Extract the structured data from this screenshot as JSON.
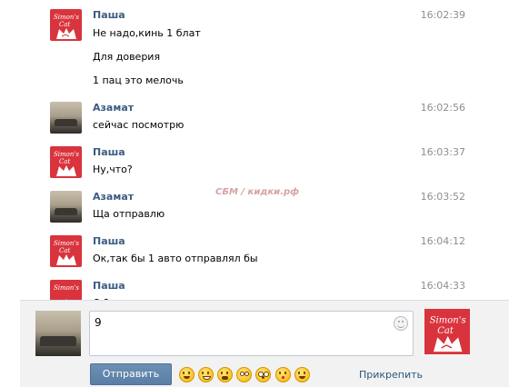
{
  "messages": [
    {
      "author": "Паша",
      "time": "16:02:39",
      "lines": [
        "Не надо,кинь 1 блат",
        "Для доверия",
        "1 пац это мелочь"
      ],
      "avatar_icon": "simons-cat-icon"
    },
    {
      "author": "Азамат",
      "time": "16:02:56",
      "lines": [
        "сейчас посмотрю"
      ],
      "avatar_icon": "car-photo"
    },
    {
      "author": "Паша",
      "time": "16:03:37",
      "lines": [
        "Ну,что?"
      ],
      "avatar_icon": "simons-cat-icon"
    },
    {
      "author": "Азамат",
      "time": "16:03:52",
      "lines": [
        "Ща отправлю"
      ],
      "avatar_icon": "car-photo"
    },
    {
      "author": "Паша",
      "time": "16:04:12",
      "lines": [
        "Ок,так бы 1 авто отправлял бы"
      ],
      "avatar_icon": "simons-cat-icon"
    },
    {
      "author": "Паша",
      "time": "16:04:33",
      "lines": [
        "О          ?"
      ],
      "avatar_icon": "simons-cat-icon"
    }
  ],
  "watermark": "СБМ / кидки.рф",
  "composer": {
    "input_value": "9",
    "send_label": "Отправить",
    "attach_label": "Прикрепить",
    "emoji_icons": [
      "weary-face-icon",
      "grimacing-face-icon",
      "screaming-face-icon",
      "flushed-face-icon",
      "astonished-face-icon",
      "kissing-face-icon",
      "smiling-face-icon"
    ]
  },
  "colors": {
    "author": "#3b5c82",
    "send_button": "#5e81a8",
    "avatar_cat": "#d9343d",
    "link": "#2b587a"
  }
}
